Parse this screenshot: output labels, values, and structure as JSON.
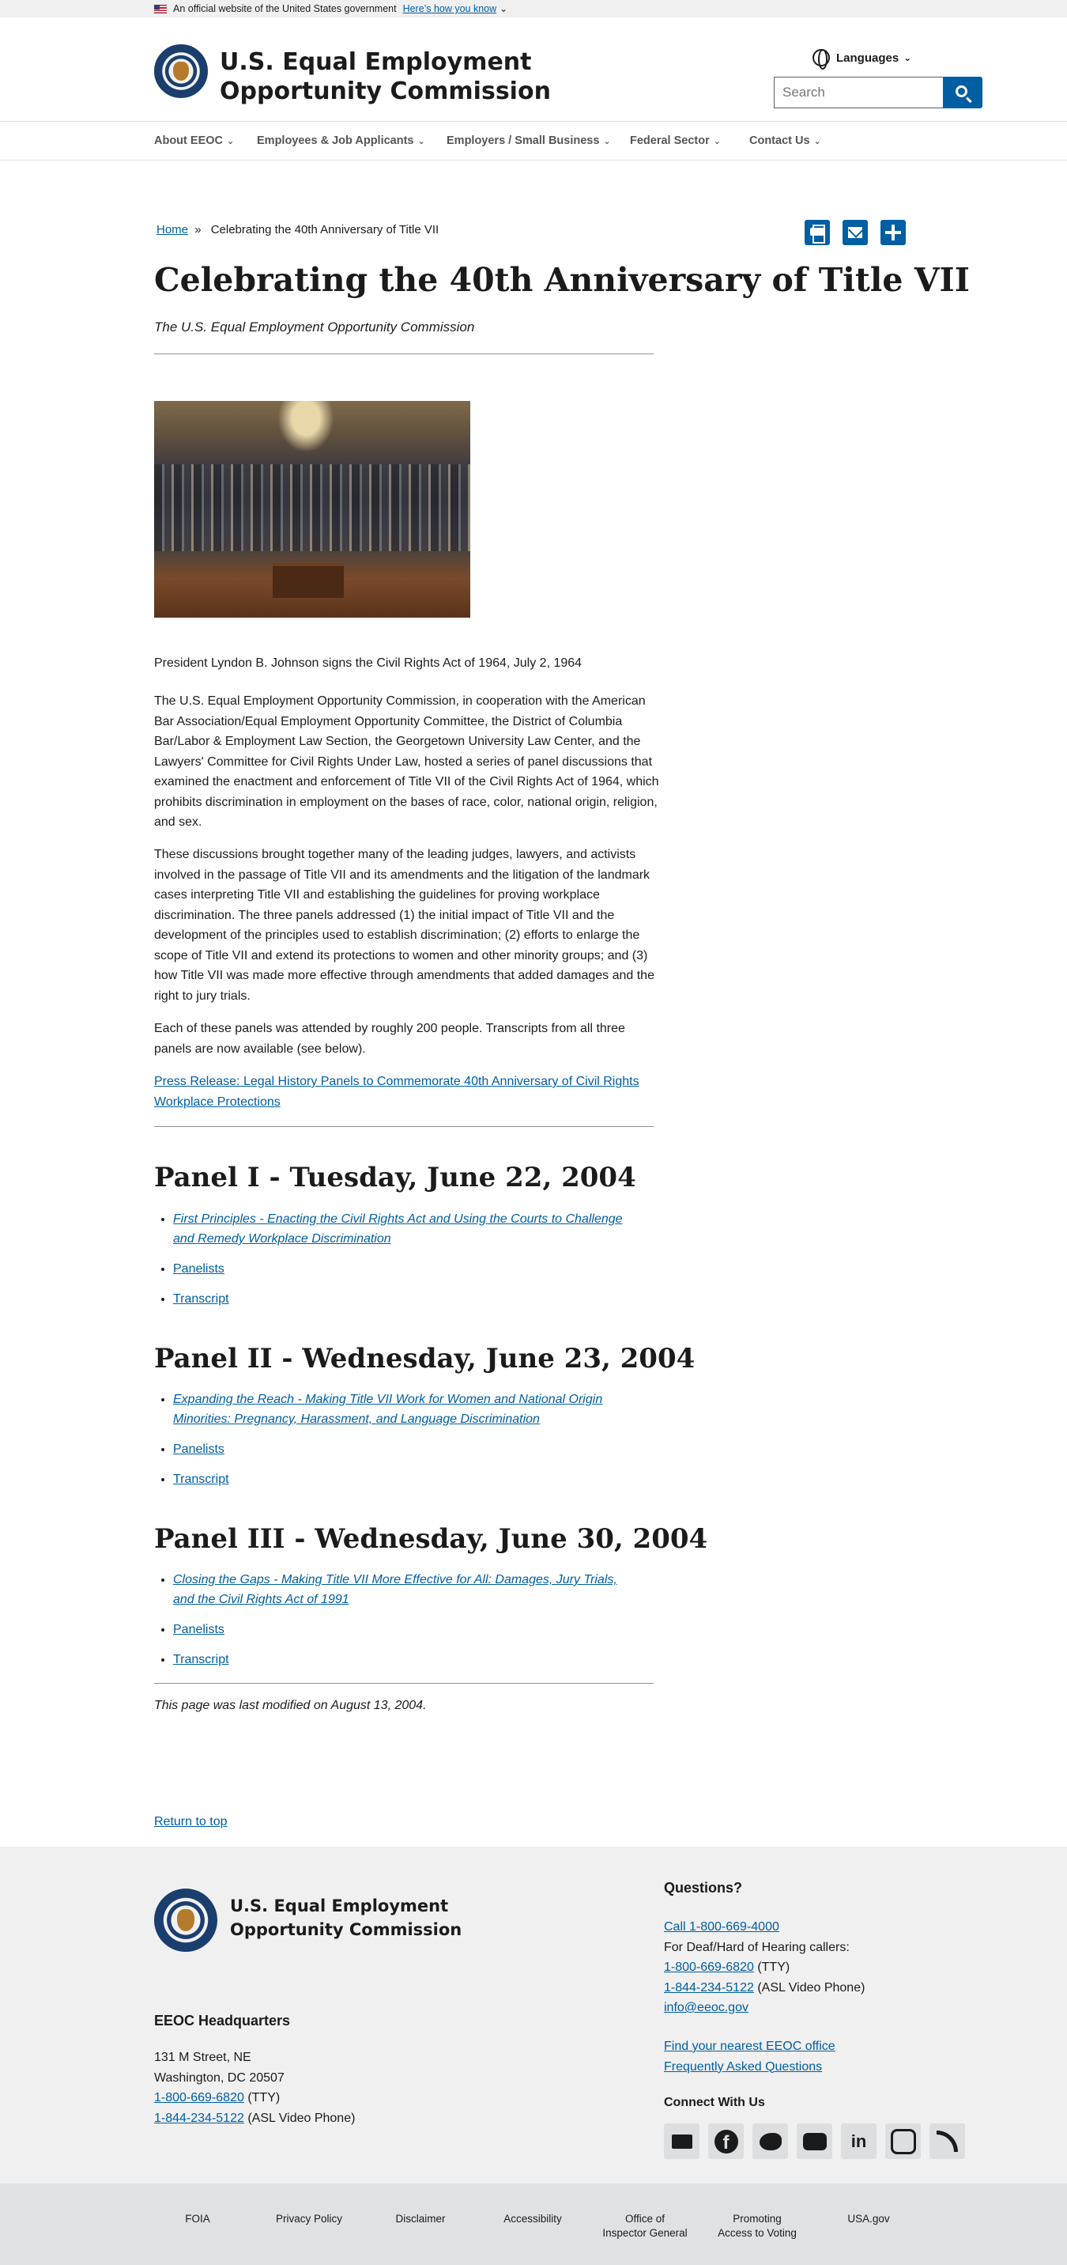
{
  "gov_banner": {
    "text": "An official website of the United States government",
    "link": "Here’s how you know"
  },
  "header": {
    "agency_line1": "U.S. Equal Employment",
    "agency_line2": "Opportunity Commission",
    "languages": "Languages",
    "search_placeholder": "Search"
  },
  "nav": {
    "items": [
      "About EEOC",
      "Employees & Job Applicants",
      "Employers / Small Business",
      "Federal Sector",
      "Contact Us"
    ]
  },
  "breadcrumb": {
    "home": "Home",
    "separator": "»",
    "current": "Celebrating the 40th Anniversary of Title VII"
  },
  "page": {
    "title": "Celebrating the 40th Anniversary of Title VII",
    "byline": "The U.S. Equal Employment Opportunity Commission",
    "caption": "President Lyndon B. Johnson signs the Civil Rights Act of 1964, July 2, 1964",
    "paragraph1": "The U.S. Equal Employment Opportunity Commission, in cooperation with the American Bar Association/Equal Employment Opportunity Committee, the District of Columbia Bar/Labor & Employment Law Section, the Georgetown University Law Center, and the Lawyers' Committee for Civil Rights Under Law, hosted a series of panel discussions that examined the enactment and enforcement of Title VII of the Civil Rights Act of 1964, which prohibits discrimination in employment on the bases of race, color, national origin, religion, and sex.",
    "paragraph2": "These discussions brought together many of the leading judges, lawyers, and activists involved in the passage of Title VII and its amendments and the litigation of the landmark cases interpreting Title VII and establishing the guidelines for proving workplace discrimination. The three panels addressed (1) the initial impact of Title VII and the development of the principles used to establish discrimination; (2) efforts to enlarge the scope of Title VII and extend its protections to women and other minority groups; and (3) how Title VII was made more effective through amendments that added damages and the right to jury trials.",
    "paragraph3": "Each of these panels was attended by roughly 200 people. Transcripts from all three panels are now available (see below).",
    "press_release": "Press Release: Legal History Panels to Commemorate 40th Anniversary of Civil Rights Workplace Protections",
    "last_modified": "This page was last modified on August 13, 2004.",
    "return_to_top": "Return to top"
  },
  "panels": [
    {
      "heading": "Panel I - Tuesday, June 22, 2004",
      "topic": "First Principles - Enacting the Civil Rights Act and Using the Courts to Challenge and Remedy Workplace Discrimination",
      "panelists": "Panelists",
      "transcript": "Transcript"
    },
    {
      "heading": "Panel II - Wednesday, June 23, 2004",
      "topic": "Expanding the Reach - Making Title VII Work for Women and National Origin Minorities: Pregnancy, Harassment, and Language Discrimination",
      "panelists": "Panelists",
      "transcript": "Transcript"
    },
    {
      "heading": "Panel III - Wednesday, June 30, 2004",
      "topic": "Closing the Gaps - Making Title VII More Effective for All: Damages, Jury Trials, and the Civil Rights Act of 1991",
      "panelists": "Panelists",
      "transcript": "Transcript"
    }
  ],
  "footer": {
    "agency_line1": "U.S. Equal Employment",
    "agency_line2": "Opportunity Commission",
    "hq_heading": "EEOC Headquarters",
    "address1": "131 M Street, NE",
    "address2": "Washington, DC 20507",
    "hq_tty_number": "1-800-669-6820",
    "tty_label": "(TTY)",
    "hq_asl_number": "1-844-234-5122",
    "asl_label": "(ASL Video Phone)",
    "questions_heading": "Questions?",
    "call": "Call 1-800-669-4000",
    "deaf_text": "For Deaf/Hard of Hearing callers:",
    "q_tty_number": "1-800-669-6820",
    "q_asl_number": "1-844-234-5122",
    "email": "info@eeoc.gov",
    "find_office": "Find your nearest EEOC office",
    "faq": "Frequently Asked Questions",
    "connect_heading": "Connect With Us",
    "social_icons": [
      "mail-icon",
      "facebook-icon",
      "twitter-icon",
      "youtube-icon",
      "linkedin-icon",
      "instagram-icon",
      "rss-icon"
    ]
  },
  "bottom_links": {
    "foia": "FOIA",
    "privacy": "Privacy Policy",
    "disclaimer": "Disclaimer",
    "accessibility": "Accessibility",
    "oig_line1": "Office of",
    "oig_line2": "Inspector General",
    "voting_line1": "Promoting",
    "voting_line2": "Access to Voting",
    "usagov": "USA.gov"
  },
  "colors": {
    "link": "#005ea2",
    "primary_button": "#005ea2",
    "footer_bg": "#f0f0f0",
    "bottom_bar_bg": "#dfe1e2"
  }
}
